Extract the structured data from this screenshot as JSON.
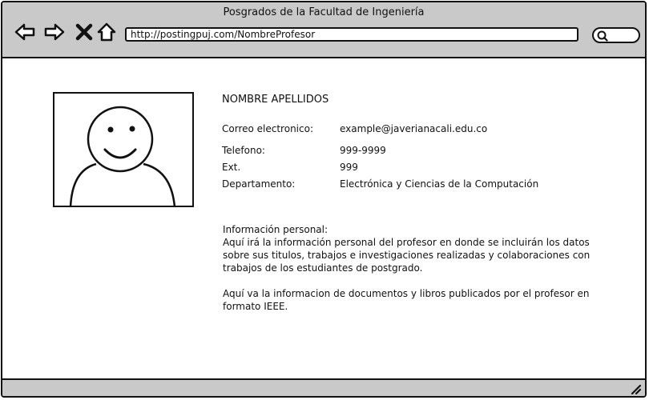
{
  "window": {
    "title": "Posgrados de la Facultad de Ingeniería",
    "url": "http://postingpuj.com/NombreProfesor"
  },
  "toolbar_icons": [
    "back-arrow-icon",
    "forward-arrow-icon",
    "close-icon",
    "home-icon",
    "search-icon"
  ],
  "profile": {
    "name": "NOMBRE APELLIDOS",
    "fields": [
      {
        "label": "Correo electronico:",
        "value": "example@javerianacali.edu.co"
      },
      {
        "label": "Telefono:",
        "value": "999-9999"
      },
      {
        "label": "Ext.",
        "value": "999"
      },
      {
        "label": "Departamento:",
        "value": "Electrónica y Ciencias de la Computación"
      }
    ],
    "personal_title": "Información personal:",
    "personal_text": "Aquí irá la información personal del profesor en donde se incluirán los datos sobre sus titulos, trabajos e investigaciones realizadas y colaboraciones con trabajos de los estudiantes de postgrado.",
    "publications_text": "Aquí va la informacion de documentos y libros publicados por el profesor en formato IEEE."
  }
}
